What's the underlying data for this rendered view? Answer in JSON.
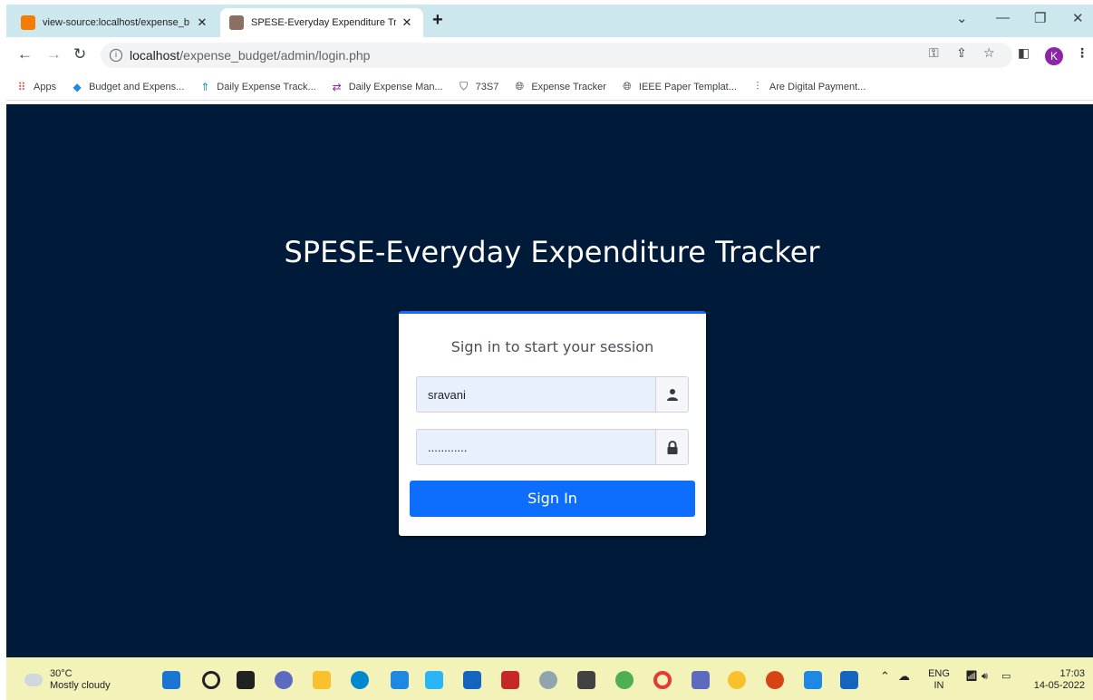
{
  "browser": {
    "tabs": [
      {
        "title": "view-source:localhost/expense_b",
        "close": "✕"
      },
      {
        "title": "SPESE-Everyday Expenditure Trac",
        "close": "✕"
      }
    ],
    "new_tab": "+",
    "address": {
      "host": "localhost",
      "path": "/expense_budget/admin/login.php",
      "info": "i"
    },
    "profile_initial": "K",
    "bookmarks": [
      {
        "label": "Apps",
        "icon": "apps-grid-icon"
      },
      {
        "label": "Budget and Expens...",
        "icon": "drop-icon"
      },
      {
        "label": "Daily Expense Track...",
        "icon": "tree-icon"
      },
      {
        "label": "Daily Expense Man...",
        "icon": "arrows-icon"
      },
      {
        "label": "73S7",
        "icon": "chair-icon"
      },
      {
        "label": "Expense Tracker",
        "icon": "globe-icon"
      },
      {
        "label": "IEEE Paper Templat...",
        "icon": "globe-icon"
      },
      {
        "label": "Are Digital Payment...",
        "icon": "chart-icon"
      }
    ]
  },
  "page": {
    "title": "SPESE-Everyday Expenditure Tracker",
    "login": {
      "message": "Sign in to start your session",
      "username_value": "sravani",
      "password_value": "............",
      "submit_label": "Sign In"
    },
    "colors": {
      "background": "#001a3a",
      "accent": "#0d6efd"
    }
  },
  "taskbar": {
    "weather_temp": "30°C",
    "weather_desc": "Mostly cloudy",
    "lang_top": "ENG",
    "lang_bottom": "IN",
    "time": "17:03",
    "date": "14-05-2022"
  }
}
